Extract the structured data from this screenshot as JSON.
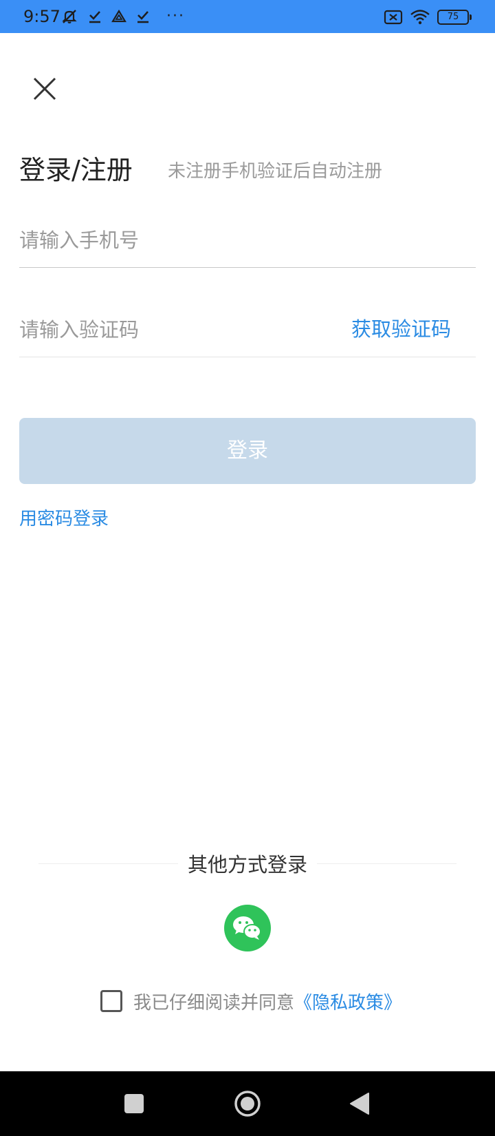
{
  "status_bar": {
    "time": "9:57",
    "more": "···",
    "battery": "75",
    "icons": [
      "mute-icon",
      "check-icon",
      "drive-icon",
      "check-icon",
      "no-sim-icon",
      "wifi-icon",
      "battery-icon"
    ]
  },
  "header": {
    "title": "登录/注册",
    "subtitle": "未注册手机验证后自动注册"
  },
  "form": {
    "phone_placeholder": "请输入手机号",
    "code_placeholder": "请输入验证码",
    "get_code_label": "获取验证码",
    "login_label": "登录",
    "password_login_label": "用密码登录"
  },
  "other_login": {
    "label": "其他方式登录",
    "icon": "wechat-icon"
  },
  "agreement": {
    "text": "我已仔细阅读并同意",
    "link": "《隐私政策》"
  },
  "colors": {
    "status_bar": "#3a8ff6",
    "accent": "#2a8be3",
    "login_button_disabled": "#c6d9ea",
    "wechat": "#2fc35a"
  },
  "nav_bar": {
    "icons": [
      "recents-icon",
      "home-icon",
      "back-icon"
    ]
  }
}
